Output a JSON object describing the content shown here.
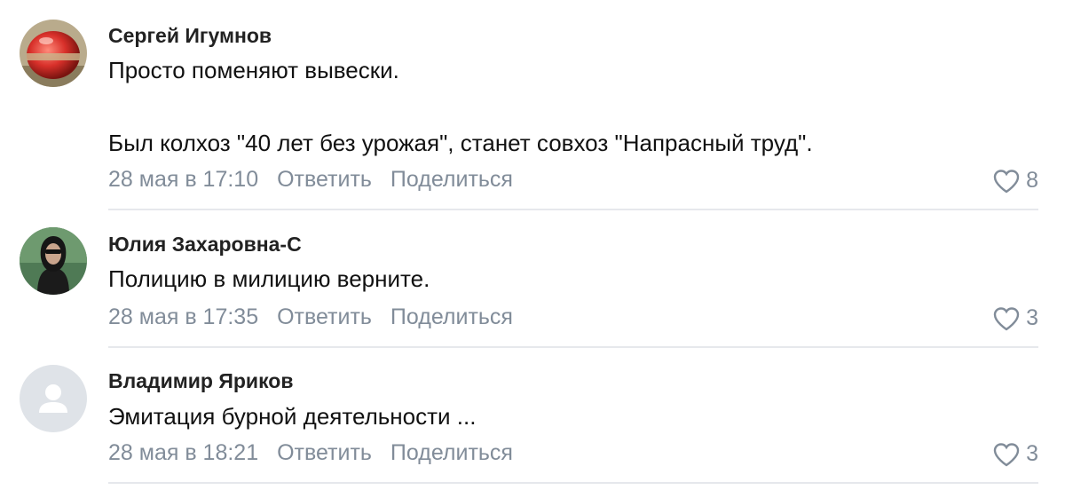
{
  "comments": [
    {
      "author": "Сергей Игумнов",
      "text_lines": [
        "Просто поменяют вывески.",
        "",
        "Был колхоз \"40 лет без урожая\", станет совхоз \"Напрасный труд\"."
      ],
      "time": "28 мая в 17:10",
      "reply_label": "Ответить",
      "share_label": "Поделиться",
      "likes": "8"
    },
    {
      "author": "Юлия Захаровна-С",
      "text_lines": [
        "Полицию в милицию верните."
      ],
      "time": "28 мая в 17:35",
      "reply_label": "Ответить",
      "share_label": "Поделиться",
      "likes": "3"
    },
    {
      "author": "Владимир Яриков",
      "text_lines": [
        "Эмитация бурной деятельности ..."
      ],
      "time": "28 мая в 18:21",
      "reply_label": "Ответить",
      "share_label": "Поделиться",
      "likes": "3"
    }
  ],
  "icons": {
    "like": "heart-outline-icon",
    "default_avatar": "user-silhouette-icon"
  },
  "colors": {
    "meta": "#818c99",
    "divider": "#e6e8ec",
    "default_avatar_bg": "#dfe3e8"
  }
}
